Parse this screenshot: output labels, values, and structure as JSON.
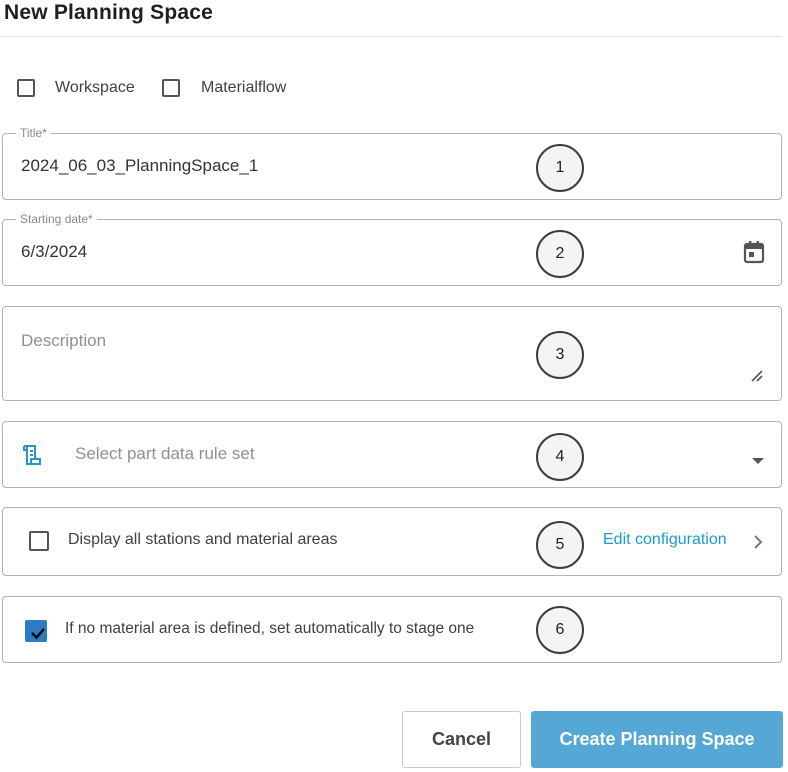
{
  "dialog": {
    "title": "New Planning Space"
  },
  "type_options": [
    {
      "label": "Workspace",
      "checked": false
    },
    {
      "label": "Materialflow",
      "checked": false
    }
  ],
  "fields": {
    "title": {
      "label": "Title*",
      "value": "2024_06_03_PlanningSpace_1"
    },
    "starting_date": {
      "label": "Starting date*",
      "value": "6/3/2024",
      "icon": "calendar-icon"
    },
    "description": {
      "placeholder": "Description",
      "value": ""
    },
    "rule_set": {
      "placeholder": "Select part data rule set",
      "icon": "rule-set-icon"
    }
  },
  "display_all": {
    "label": "Display all stations and material areas",
    "checked": false,
    "link_label": "Edit configuration"
  },
  "auto_stage": {
    "label": "If no material area is defined, set automatically to stage one",
    "checked": true
  },
  "markers": [
    "1",
    "2",
    "3",
    "4",
    "5",
    "6"
  ],
  "buttons": {
    "cancel": "Cancel",
    "create": "Create Planning Space"
  },
  "colors": {
    "accent": "#55a8d6",
    "link": "#1a9bd1",
    "checkbox": "#2b7cc4"
  }
}
